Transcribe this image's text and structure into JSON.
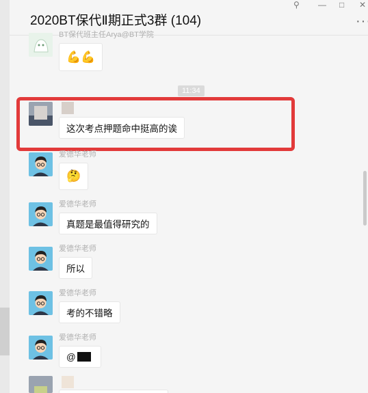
{
  "window": {
    "title": "2020BT保代Ⅱ期正式3群 (104)",
    "more_icon": "···",
    "pin_icon": "⚲",
    "minimize_icon": "—",
    "maximize_icon": "□",
    "close_icon": "✕"
  },
  "colors": {
    "highlight_border": "#e23a3a",
    "bubble_bg": "#ffffff",
    "chat_bg": "#f5f5f5"
  },
  "timestamp": "11:34",
  "messages": [
    {
      "sender": "BT保代班主任Arya@BT学院",
      "text": "💪💪",
      "avatar": "cartoon-avatar"
    },
    {
      "sender": "",
      "text": "这次考点押题命中挺高的诶",
      "avatar": "blurred-avatar",
      "highlighted": true
    },
    {
      "sender": "爱德华老师",
      "text": "🤔",
      "avatar": "teacher-avatar"
    },
    {
      "sender": "爱德华老师",
      "text": "真题是最值得研究的",
      "avatar": "teacher-avatar"
    },
    {
      "sender": "爱德华老师",
      "text": "所以",
      "avatar": "teacher-avatar"
    },
    {
      "sender": "爱德华老师",
      "text": "考的不错略",
      "avatar": "teacher-avatar"
    },
    {
      "sender": "爱德华老师",
      "text": "@",
      "avatar": "teacher-avatar"
    }
  ]
}
